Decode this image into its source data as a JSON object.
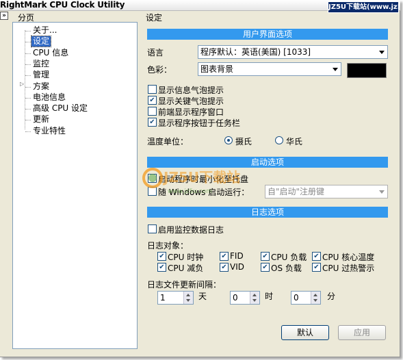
{
  "window": {
    "title": "RightMark CPU Clock Utility",
    "watermark": "JZ5U下载站(www.jz5u.com)"
  },
  "left": {
    "collapse_icon": "double-chevron-right-icon",
    "header": "分页",
    "items": [
      {
        "label": "关于..."
      },
      {
        "label": "设定",
        "selected": true
      },
      {
        "label": "CPU 信息"
      },
      {
        "label": "监控"
      },
      {
        "label": "管理"
      },
      {
        "label": "方案",
        "expandable": true
      },
      {
        "label": "电池信息"
      },
      {
        "label": "高级 CPU 设定"
      },
      {
        "label": "更新"
      },
      {
        "label": "专业特性"
      }
    ]
  },
  "right": {
    "header": "设定",
    "ui_section": {
      "title": "用户界面选项",
      "language_label": "语言",
      "language_value": "程序默认：英语(美国) [1033]",
      "color_label": "色彩：",
      "color_value": "图表背景",
      "color_swatch": "#000000",
      "checkboxes": [
        {
          "label": "显示信息气泡提示",
          "checked": false
        },
        {
          "label": "显示关键气泡提示",
          "checked": true
        },
        {
          "label": "前端显示程序窗口",
          "checked": false
        },
        {
          "label": "显示程序按钮于任务栏",
          "checked": true
        }
      ],
      "temp_label": "温度单位：",
      "temp_options": [
        {
          "label": "摄氏",
          "selected": true
        },
        {
          "label": "华氏",
          "selected": false
        }
      ]
    },
    "startup_section": {
      "title": "启动选项",
      "minimize_label": "启动程序时最小化至托盘",
      "minimize_checked": false,
      "autorun_label": "随 Windows 启动运行：",
      "autorun_checked": false,
      "autorun_value": "自\"启动\"注册键"
    },
    "log_section": {
      "title": "日志选项",
      "enable_label": "启用监控数据日志",
      "enable_checked": false,
      "targets_label": "日志对象：",
      "targets": [
        {
          "label": "CPU 时钟",
          "checked": true
        },
        {
          "label": "FID",
          "checked": true
        },
        {
          "label": "CPU 负载",
          "checked": true
        },
        {
          "label": "CPU 核心温度",
          "checked": true
        },
        {
          "label": "CPU 减负",
          "checked": true
        },
        {
          "label": "VID",
          "checked": true
        },
        {
          "label": "OS 负载",
          "checked": true
        },
        {
          "label": "CPU 过热警示",
          "checked": true
        }
      ],
      "interval_label": "日志文件更新间隔：",
      "days_value": "1",
      "days_unit": "天",
      "hours_value": "0",
      "hours_unit": "时",
      "minutes_value": "0",
      "minutes_unit": "分"
    },
    "buttons": {
      "default_label": "默认",
      "apply_label": "应用"
    }
  },
  "watermark_logo": {
    "text": "JZ5U下载站",
    "url_text": "www.jz5u.com",
    "colors": {
      "orange": "#f39a1e",
      "green": "#5aa03c"
    }
  }
}
